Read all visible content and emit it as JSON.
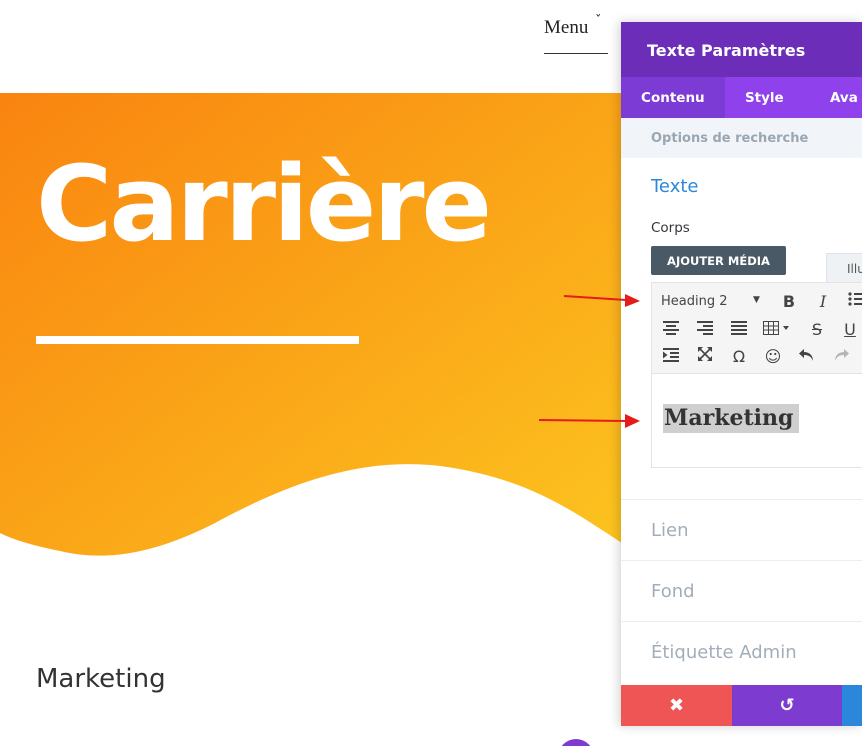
{
  "nav": {
    "menu_label": "Menu",
    "chevron": "ˇ"
  },
  "hero": {
    "title": "Carrière"
  },
  "page": {
    "section_heading": "Marketing"
  },
  "panel": {
    "title": "Texte Paramètres",
    "tabs": [
      {
        "label": "Contenu",
        "active": true
      },
      {
        "label": "Style",
        "active": false
      },
      {
        "label": "Ava",
        "active": false
      }
    ],
    "search_placeholder": "Options de recherche",
    "section_title": "Texte",
    "body_label": "Corps",
    "add_media_label": "AJOUTER MÉDIA",
    "editor_mode_tab": "Illu",
    "toolbar": {
      "format_value": "Heading 2",
      "bold_glyph": "B",
      "italic_glyph": "I",
      "strike_glyph": "S",
      "underline_glyph": "U",
      "omega_glyph": "Ω"
    },
    "editor_content": "Marketing",
    "toggles": [
      "Lien",
      "Fond",
      "Étiquette Admin"
    ]
  },
  "footer": {
    "cancel_glyph": "✖",
    "undo_glyph": "↺"
  },
  "colors": {
    "hero_gradient_start": "#f98c12",
    "hero_gradient_end": "#fcc01d",
    "panel_header": "#6c2eb9",
    "tab_bar": "#8f42ec",
    "accent_blue": "#2b87da",
    "cancel_red": "#ef5555",
    "undo_purple": "#7e3bd0",
    "arrow_red": "#e51c1c"
  }
}
